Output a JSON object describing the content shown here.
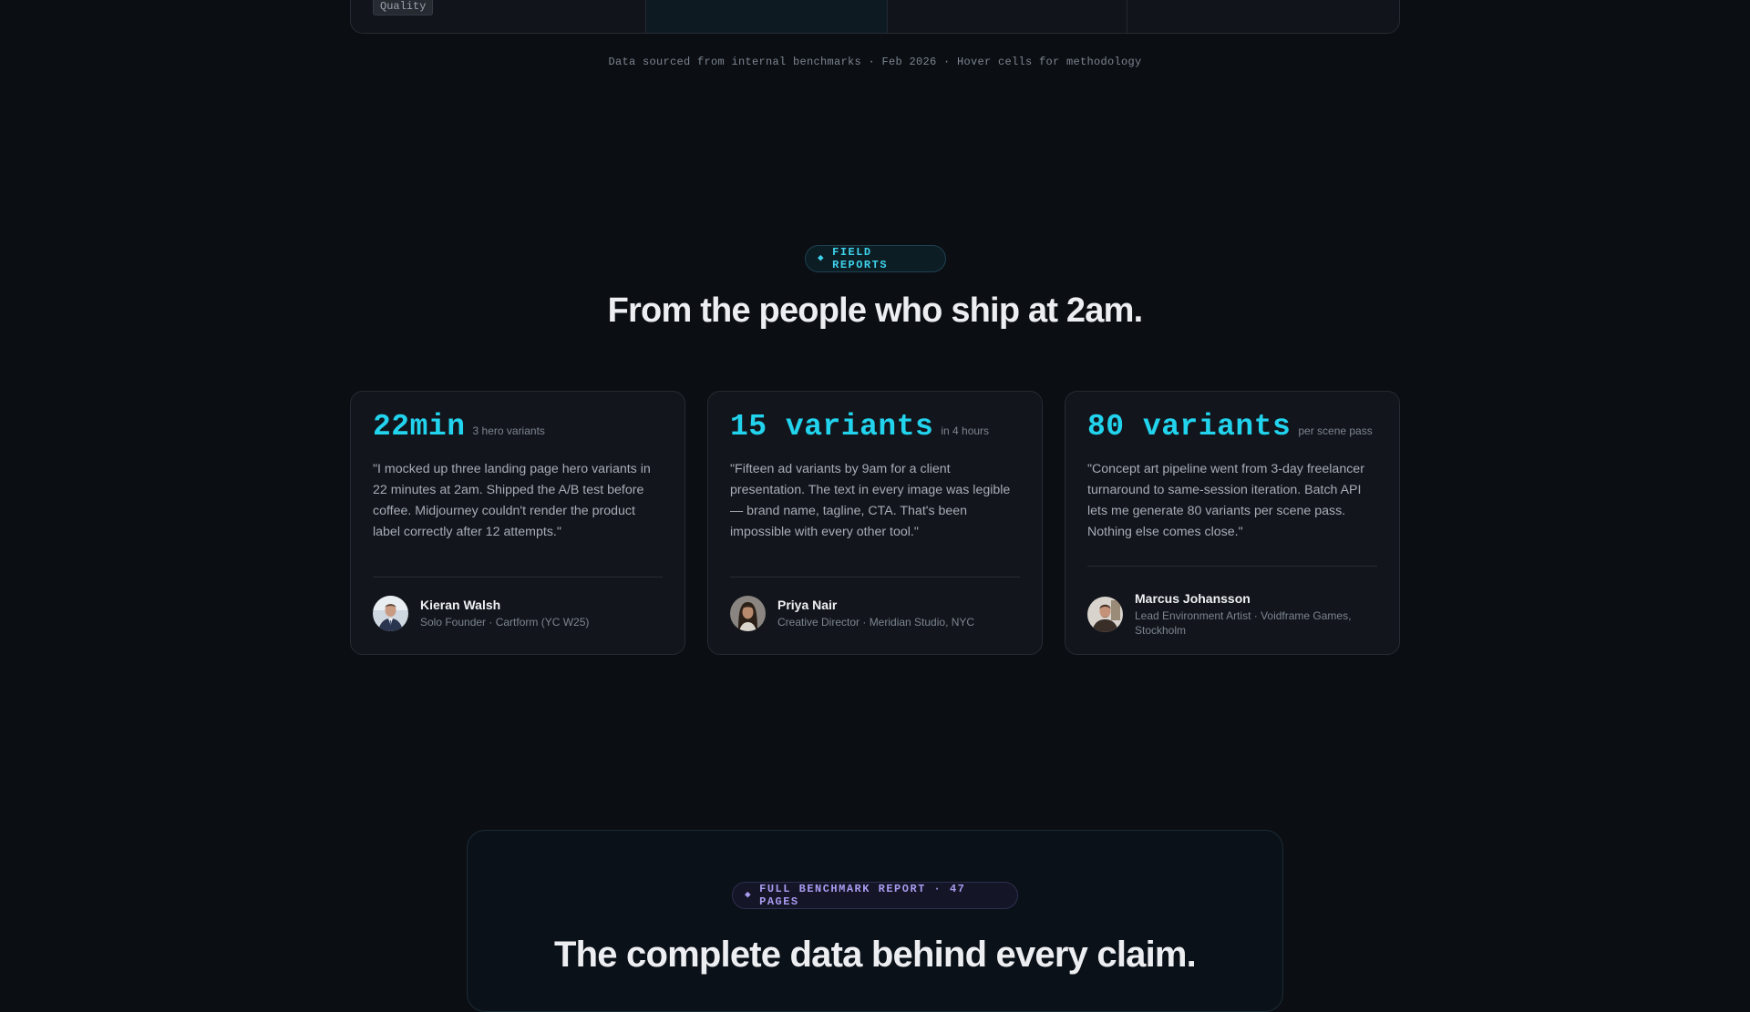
{
  "table": {
    "quality_tag": "Quality",
    "footnote": "Data sourced from internal benchmarks · Feb 2026 · Hover cells for methodology"
  },
  "field_reports": {
    "badge": "FIELD REPORTS",
    "title": "From the people who ship at 2am.",
    "accent_color": "#22d3ee",
    "cards": [
      {
        "metric": "22min",
        "metric_note": "3 hero variants",
        "quote": "\"I mocked up three landing page hero variants in 22 minutes at 2am. Shipped the A/B test before coffee. Midjourney couldn't render the product label correctly after 12 attempts.\"",
        "name": "Kieran Walsh",
        "role": "Solo Founder · Cartform (YC W25)"
      },
      {
        "metric": "15 variants",
        "metric_note": "in 4 hours",
        "quote": "\"Fifteen ad variants by 9am for a client presentation. The text in every image was legible — brand name, tagline, CTA. That's been impossible with every other tool.\"",
        "name": "Priya Nair",
        "role": "Creative Director · Meridian Studio, NYC"
      },
      {
        "metric": "80 variants",
        "metric_note": "per scene pass",
        "quote": "\"Concept art pipeline went from 3-day freelancer turnaround to same-session iteration. Batch API lets me generate 80 variants per scene pass. Nothing else comes close.\"",
        "name": "Marcus Johansson",
        "role": "Lead Environment Artist · Voidframe Games, Stockholm"
      }
    ]
  },
  "report": {
    "badge": "FULL BENCHMARK REPORT · 47 PAGES",
    "title": "The complete data behind every claim.",
    "accent_color": "#a89cf0"
  }
}
